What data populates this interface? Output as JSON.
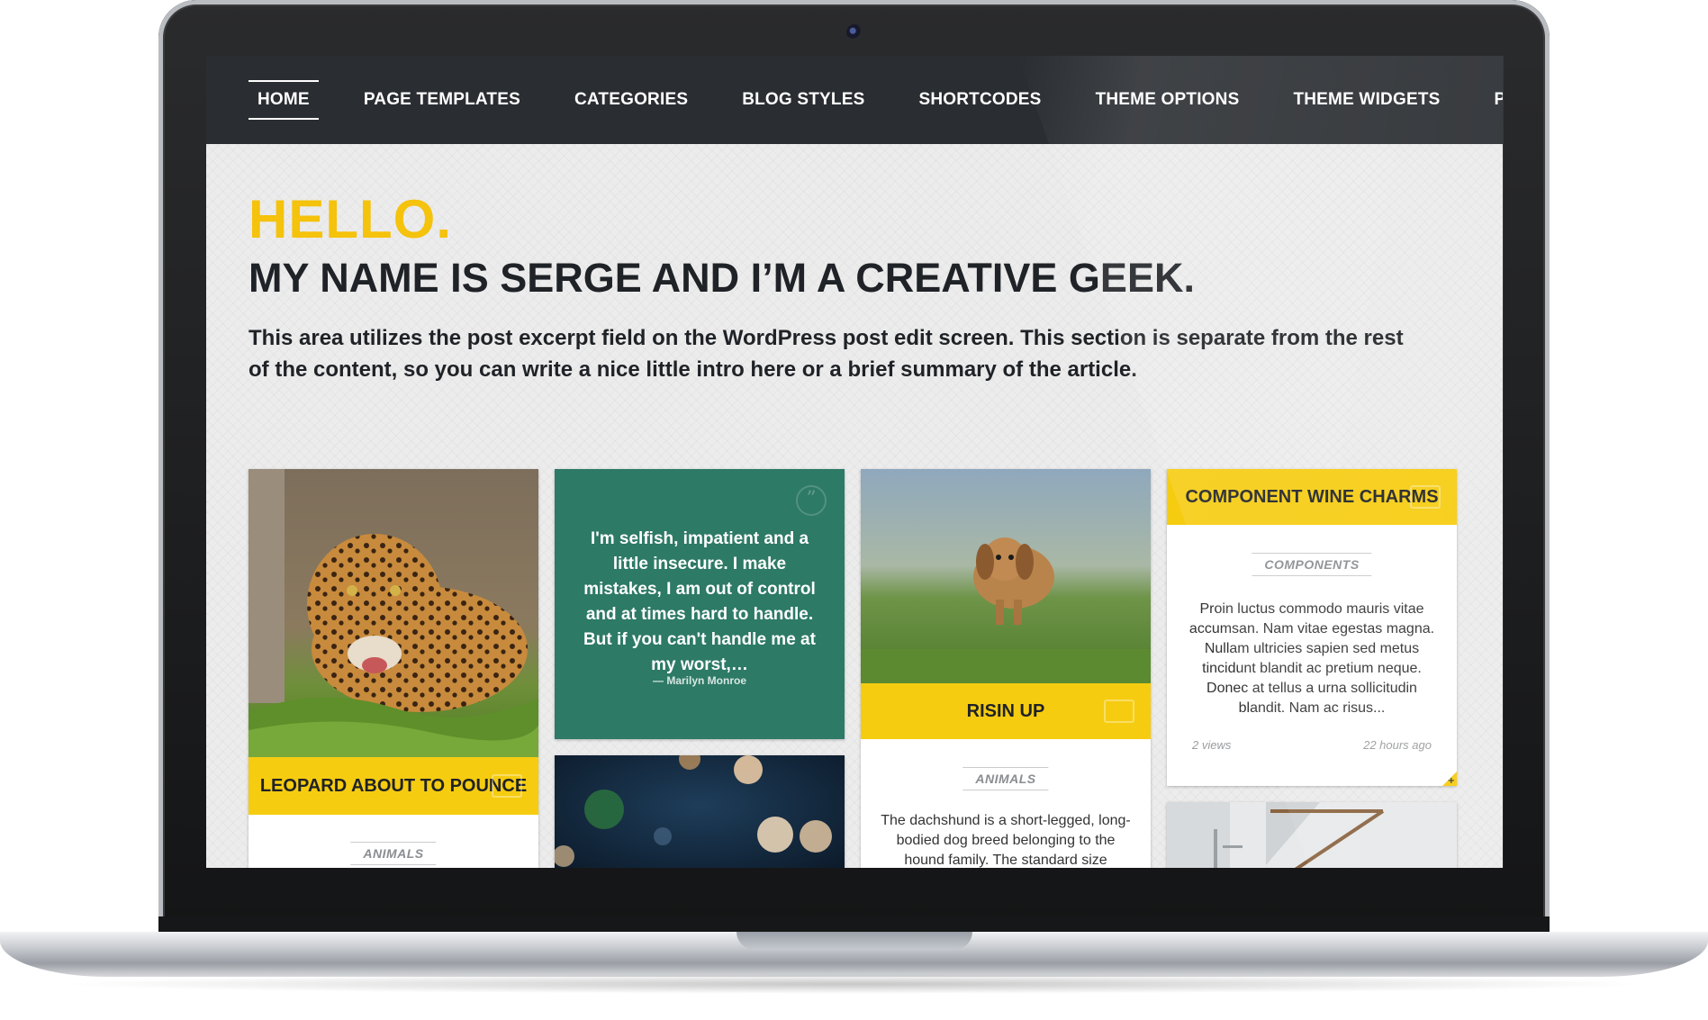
{
  "nav": {
    "items": [
      "HOME",
      "PAGE TEMPLATES",
      "CATEGORIES",
      "BLOG STYLES",
      "SHORTCODES",
      "THEME OPTIONS",
      "THEME WIDGETS",
      "POST FORMATS"
    ],
    "active_index": 0
  },
  "hero": {
    "hello": "HELLO.",
    "headline": "MY NAME IS SERGE AND I’M A CREATIVE GEEK.",
    "intro": "This area utilizes the post excerpt field on the WordPress post edit screen. This section is separate from the rest of the content, so you can write a nice little intro here or a brief summary of the article."
  },
  "posts": {
    "leopard": {
      "title": "LEOPARD ABOUT TO POUNCE",
      "category": "ANIMALS"
    },
    "quote": {
      "text": "I'm selfish, impatient and a little insecure. I make mistakes, I am out of control and at times hard to handle. But if you can't handle me at my worst,…",
      "author": "— Marilyn Monroe"
    },
    "dog": {
      "title": "RISIN UP",
      "category": "ANIMALS",
      "excerpt": "The dachshund is a short-legged, long-bodied dog breed belonging to the hound family. The standard size"
    },
    "wine": {
      "title": "COMPONENT WINE CHARMS",
      "category": "COMPONENTS",
      "excerpt": "Proin luctus commodo mauris vitae accumsan. Nam vitae egestas magna. Nullam ultricies sapien sed metus tincidunt blandit ac pretium neque. Donec at tellus a urna sollicitudin blandit. Nam ac risus...",
      "views": "2 views",
      "time": "22 hours ago"
    }
  },
  "colors": {
    "accent": "#f6cc11",
    "nav_bg": "#2a2d31",
    "quote_bg": "#2d7a66"
  }
}
